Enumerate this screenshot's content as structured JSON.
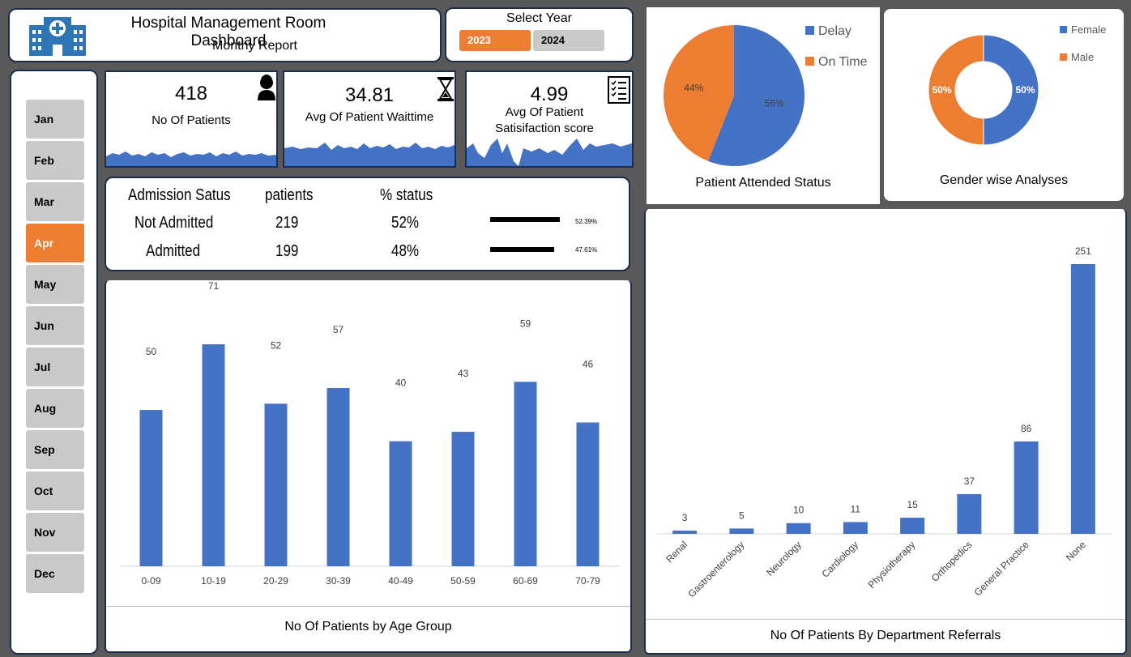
{
  "header": {
    "title": "Hospital Management Room Dashboard",
    "subtitle": "Monthy Report",
    "logo_icon": "hospital-icon"
  },
  "year_select": {
    "label": "Select Year",
    "years": [
      "2023",
      "2024"
    ],
    "selected": "2023"
  },
  "months": {
    "items": [
      "Jan",
      "Feb",
      "Mar",
      "Apr",
      "May",
      "Jun",
      "Jul",
      "Aug",
      "Sep",
      "Oct",
      "Nov",
      "Dec"
    ],
    "selected": "Apr"
  },
  "kpis": [
    {
      "value": "418",
      "label": "No Of Patients",
      "icon": "patient-icon"
    },
    {
      "value": "34.81",
      "label": "Avg Of Patient Waittime",
      "icon": "hourglass-icon"
    },
    {
      "value": "4.99",
      "label": "Avg Of Patient Satisifaction score",
      "icon": "checklist-icon"
    }
  ],
  "admission": {
    "headers": [
      "Admission Satus",
      "patients",
      "% status"
    ],
    "rows": [
      {
        "status": "Not Admitted",
        "patients": "219",
        "pct": "52%",
        "bar_label": "52.39%",
        "fraction": 0.5239
      },
      {
        "status": "Admitted",
        "patients": "199",
        "pct": "48%",
        "bar_label": "47.61%",
        "fraction": 0.4761
      }
    ]
  },
  "colors": {
    "blue": "#4472c4",
    "orange": "#ed7d31",
    "gray": "#c9c9c9",
    "navy": "#1f2d4d"
  },
  "chart_data": [
    {
      "type": "bar",
      "title": "No Of Patients by Age Group",
      "categories": [
        "0-09",
        "10-19",
        "20-29",
        "30-39",
        "40-49",
        "50-59",
        "60-69",
        "70-79"
      ],
      "values": [
        50,
        71,
        52,
        57,
        40,
        43,
        59,
        46
      ],
      "data_labels": true,
      "grid": false
    },
    {
      "type": "bar",
      "title": "No Of Patients By Department Referrals",
      "categories": [
        "Renal",
        "Gastroenterology",
        "Neurology",
        "Cardiology",
        "Physiotherapy",
        "Orthopedics",
        "General Practice",
        "None"
      ],
      "values": [
        3,
        5,
        10,
        11,
        15,
        37,
        86,
        251
      ],
      "data_labels": true,
      "grid": false
    },
    {
      "type": "pie",
      "title": "Patient Attended Status",
      "labels": [
        "Delay",
        "On Time"
      ],
      "values": [
        56,
        44
      ],
      "value_labels": [
        "56%",
        "44%"
      ],
      "legend": "top-right"
    },
    {
      "type": "pie",
      "title": "Gender wise Analyses",
      "labels": [
        "Female",
        "Male"
      ],
      "values": [
        50,
        50
      ],
      "value_labels": [
        "50%",
        "50%"
      ],
      "legend": "top-right",
      "donut": true
    }
  ]
}
